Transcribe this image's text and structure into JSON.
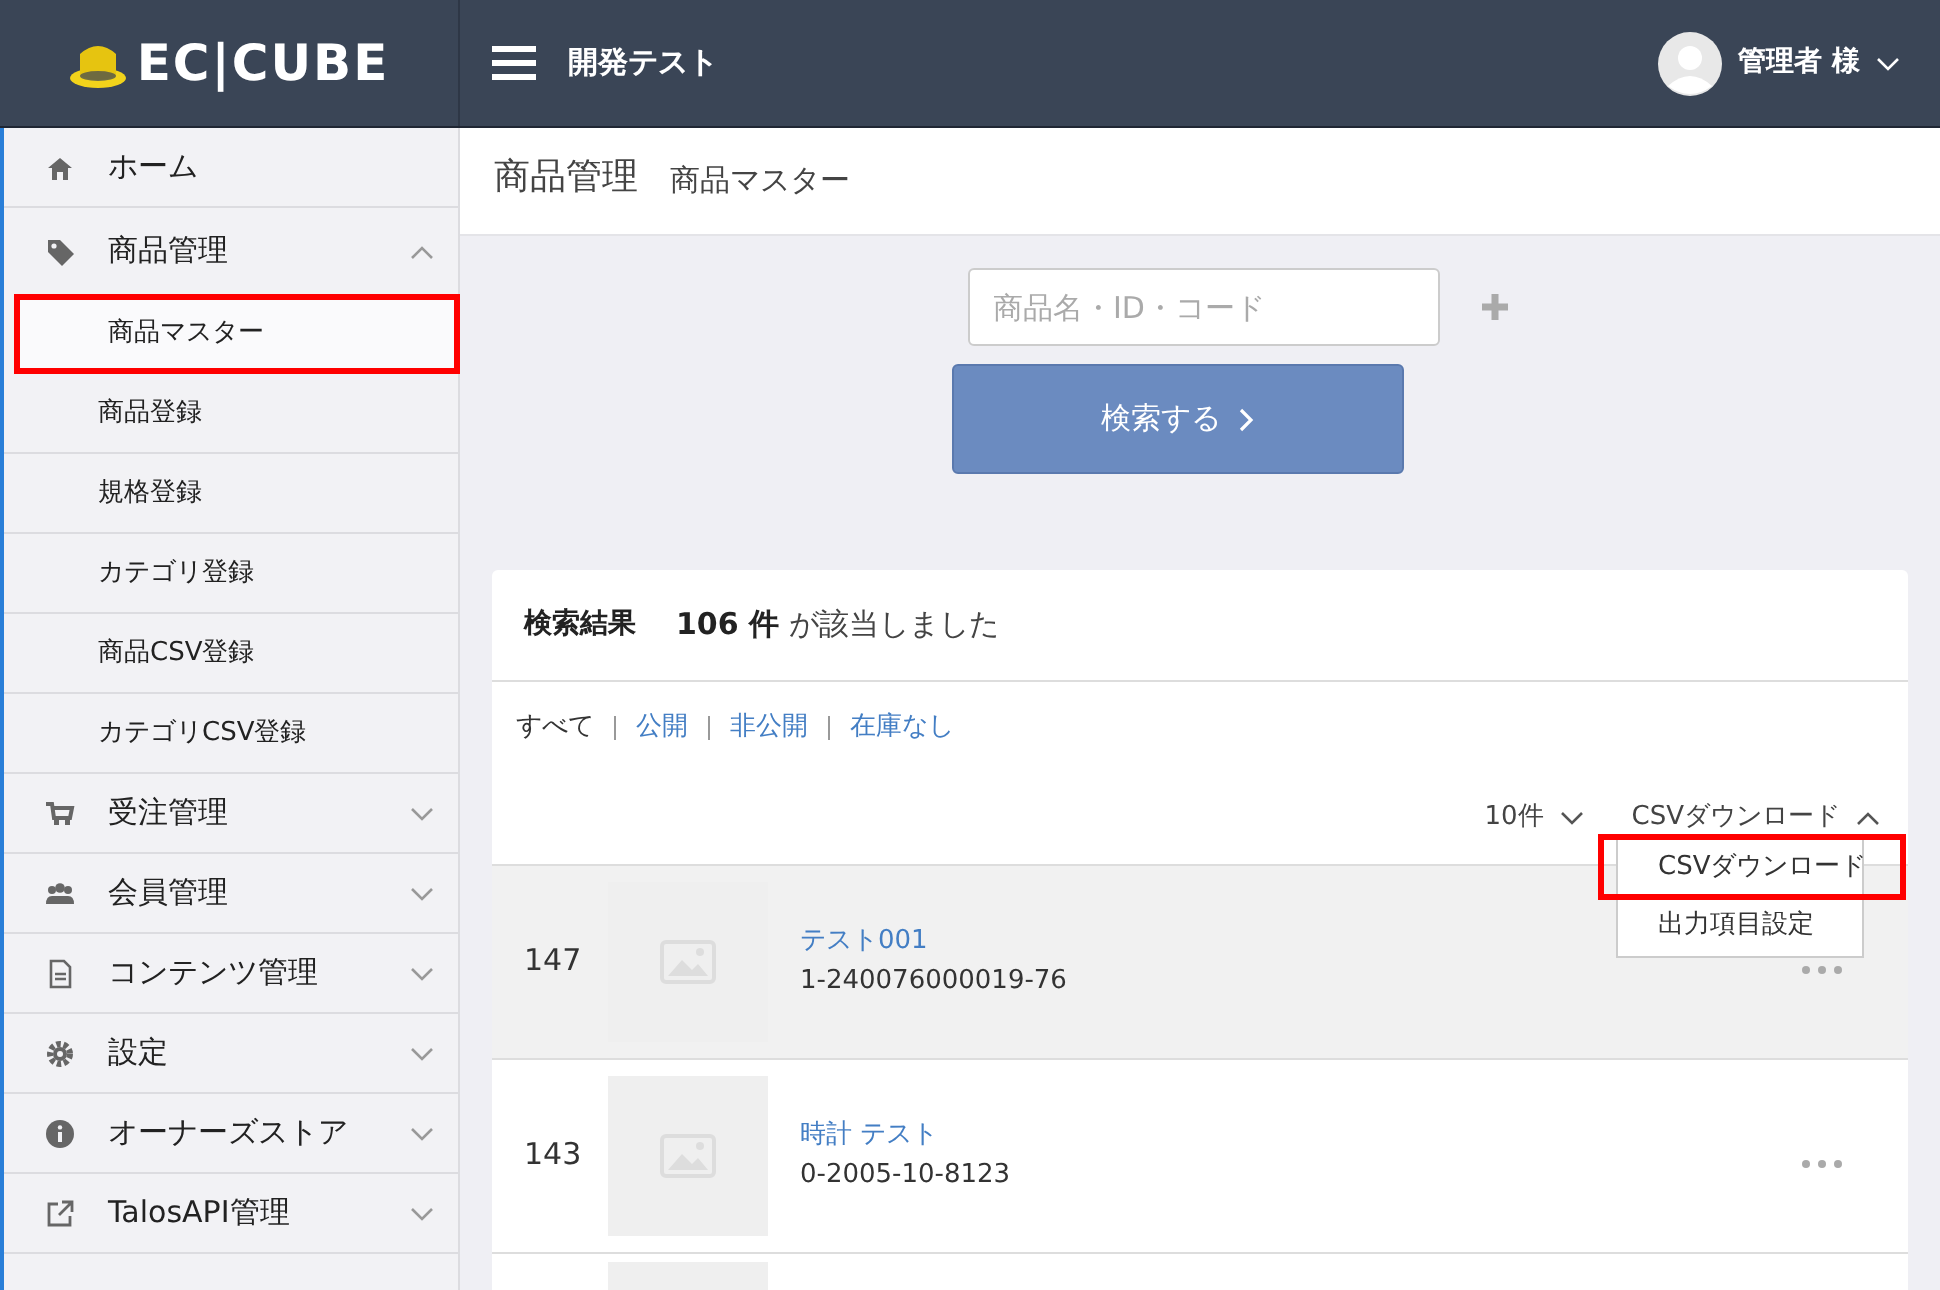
{
  "header": {
    "logo": "EC|CUBE",
    "title": "開発テスト",
    "user": "管理者 様"
  },
  "sidebar": {
    "items": [
      {
        "label": "ホーム",
        "kind": "link"
      },
      {
        "label": "商品管理",
        "kind": "group",
        "expanded": true,
        "children": [
          {
            "label": "商品マスター",
            "selected": true,
            "highlighted": true
          },
          {
            "label": "商品登録",
            "selected": false,
            "highlighted": false
          },
          {
            "label": "規格登録",
            "selected": false,
            "highlighted": false
          },
          {
            "label": "カテゴリ登録",
            "selected": false,
            "highlighted": false
          },
          {
            "label": "商品CSV登録",
            "selected": false,
            "highlighted": false
          },
          {
            "label": "カテゴリCSV登録",
            "selected": false,
            "highlighted": false
          }
        ]
      },
      {
        "label": "受注管理",
        "kind": "group",
        "expanded": false
      },
      {
        "label": "会員管理",
        "kind": "group",
        "expanded": false
      },
      {
        "label": "コンテンツ管理",
        "kind": "group",
        "expanded": false
      },
      {
        "label": "設定",
        "kind": "group",
        "expanded": false
      },
      {
        "label": "オーナーズストア",
        "kind": "group",
        "expanded": false
      },
      {
        "label": "TalosAPI管理",
        "kind": "group",
        "expanded": false
      }
    ]
  },
  "breadcrumb": {
    "title": "商品管理",
    "subtitle": "商品マスター"
  },
  "search": {
    "placeholder": "商品名・ID・コード",
    "button": "検索する"
  },
  "results": {
    "label": "検索結果",
    "count": "106 件",
    "suffix": "が該当しました",
    "filters": [
      {
        "label": "すべて",
        "selected": true
      },
      {
        "label": "公開",
        "selected": false
      },
      {
        "label": "非公開",
        "selected": false
      },
      {
        "label": "在庫なし",
        "selected": false
      }
    ],
    "page_size": "10件",
    "csv_menu": {
      "label": "CSVダウンロード",
      "expanded": true,
      "items": [
        {
          "label": "CSVダウンロード",
          "highlighted": true
        },
        {
          "label": "出力項目設定",
          "highlighted": false
        }
      ]
    },
    "rows": [
      {
        "id": "147",
        "name": "テスト001",
        "code": "1-240076000019-76",
        "hover": true
      },
      {
        "id": "143",
        "name": "時計 テスト",
        "code": "0-2005-10-8123",
        "hover": false
      }
    ]
  }
}
